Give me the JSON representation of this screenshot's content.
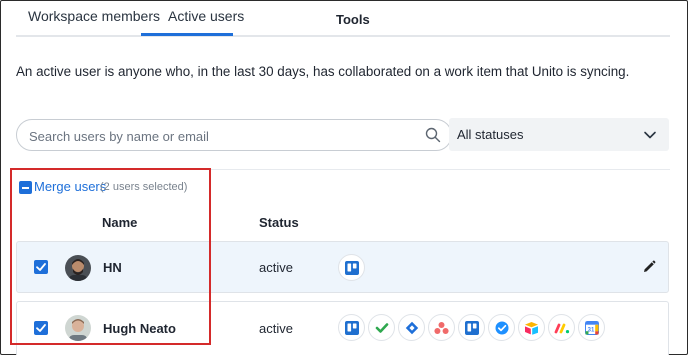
{
  "tabs": [
    {
      "label": "Workspace members"
    },
    {
      "label": "Active users"
    }
  ],
  "description": "An active user is anyone who, in the last 30 days, has collaborated on a work item that Unito is syncing.",
  "search": {
    "placeholder": "Search users by name or email"
  },
  "status_filter": {
    "selected": "All statuses"
  },
  "merge": {
    "label": "Merge users",
    "count": "(2 users selected)"
  },
  "columns": {
    "name": "Name",
    "status": "Status",
    "tools": "Tools"
  },
  "users": [
    {
      "name": "HN",
      "status": "active",
      "selected": true,
      "tools": [
        "trello-icon"
      ]
    },
    {
      "name": "Hugh Neato",
      "status": "active",
      "selected": true,
      "tools": [
        "trello-icon",
        "wrike-icon",
        "jira-icon",
        "asana-icon",
        "trello-icon",
        "microsoft-todo-icon",
        "airtable-icon",
        "monday-icon",
        "google-calendar-icon"
      ]
    }
  ],
  "colors": {
    "accent": "#1e6fd9",
    "highlight_box": "#d42a2a",
    "selected_row": "#eef5fc"
  }
}
